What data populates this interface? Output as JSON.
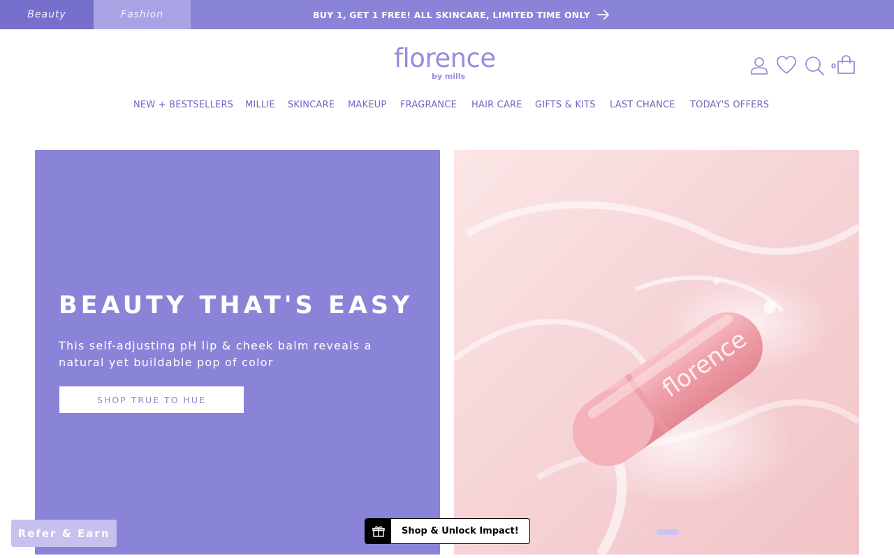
{
  "topbar": {
    "tabs": [
      {
        "label": "Beauty"
      },
      {
        "label": "Fashion"
      }
    ],
    "promo": "BUY 1, GET 1 FREE! ALL SKINCARE, LIMITED TIME ONLY"
  },
  "header": {
    "logo_text": "florence",
    "logo_sub": "by mills",
    "cart_count": "0",
    "icons": [
      "account-icon",
      "wishlist-heart-icon",
      "search-icon",
      "cart-bag-icon"
    ]
  },
  "nav": {
    "items": [
      {
        "label": "NEW + BESTSELLERS"
      },
      {
        "label": "MILLIE"
      },
      {
        "label": "SKINCARE"
      },
      {
        "label": "MAKEUP"
      },
      {
        "label": "FRAGRANCE"
      },
      {
        "label": "HAIR CARE"
      },
      {
        "label": "GIFTS & KITS"
      },
      {
        "label": "LAST CHANCE"
      },
      {
        "label": "TODAY'S OFFERS"
      }
    ]
  },
  "hero": {
    "title": "BEAUTY THAT'S EASY",
    "subtitle": "This self-adjusting pH lip & cheek balm reveals a natural yet buildable pop of color",
    "cta": "SHOP TRUE TO HUE",
    "product_text": "florence",
    "slides": {
      "count": 3,
      "active": 3
    }
  },
  "widgets": {
    "refer": "Refer & Earn",
    "impact": "Shop & Unlock Impact!"
  },
  "colors": {
    "brand": "#8a84d8",
    "nav_text": "#6e68c2",
    "hero_image_bg": "#f6d9db"
  }
}
